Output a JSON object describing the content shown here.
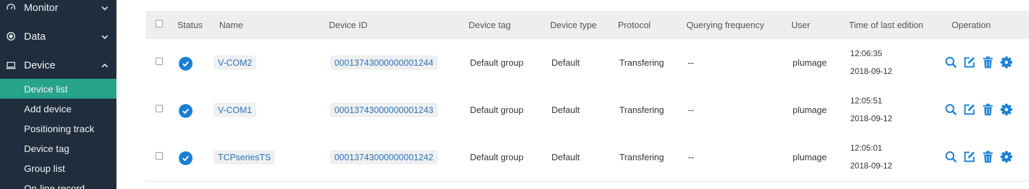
{
  "sidebar": {
    "groups": [
      {
        "label": "Monitor",
        "icon": "gauge-icon",
        "expanded": false
      },
      {
        "label": "Data",
        "icon": "radio-dot-icon",
        "expanded": false
      },
      {
        "label": "Device",
        "icon": "laptop-icon",
        "expanded": true
      }
    ],
    "device_items": [
      {
        "label": "Device list",
        "active": true
      },
      {
        "label": "Add device",
        "active": false
      },
      {
        "label": "Positioning track",
        "active": false
      },
      {
        "label": "Device tag",
        "active": false
      },
      {
        "label": "Group list",
        "active": false
      },
      {
        "label": "On-line record",
        "active": false
      }
    ]
  },
  "table": {
    "headers": {
      "status": "Status",
      "name": "Name",
      "device_id": "Device ID",
      "device_tag": "Device tag",
      "device_type": "Device type",
      "protocol": "Protocol",
      "querying_frequency": "Querying frequency",
      "user": "User",
      "time_of_last_edition": "Time of last edition",
      "operation": "Operation"
    },
    "rows": [
      {
        "name": "V-COM2",
        "device_id": "00013743000000001244",
        "device_tag": "Default group",
        "device_type": "Default",
        "protocol": "Transfering",
        "querying_frequency": "--",
        "user": "plumage",
        "time": "12:06:35",
        "date": "2018-09-12",
        "status": "online"
      },
      {
        "name": "V-COM1",
        "device_id": "00013743000000001243",
        "device_tag": "Default group",
        "device_type": "Default",
        "protocol": "Transfering",
        "querying_frequency": "--",
        "user": "plumage",
        "time": "12:05:51",
        "date": "2018-09-12",
        "status": "online"
      },
      {
        "name": "TCPseriesTS",
        "device_id": "00013743000000001242",
        "device_tag": "Default group",
        "device_type": "Default",
        "protocol": "Transfering",
        "querying_frequency": "--",
        "user": "plumage",
        "time": "12:05:01",
        "date": "2018-09-12",
        "status": "online"
      }
    ],
    "operation_icons": [
      "search-icon",
      "edit-icon",
      "trash-icon",
      "gear-icon"
    ]
  },
  "colors": {
    "sidebar_bg": "#1f2d3d",
    "active_item": "#27a38c",
    "accent_blue": "#1a7fd4",
    "header_bg": "#eeeeee"
  }
}
